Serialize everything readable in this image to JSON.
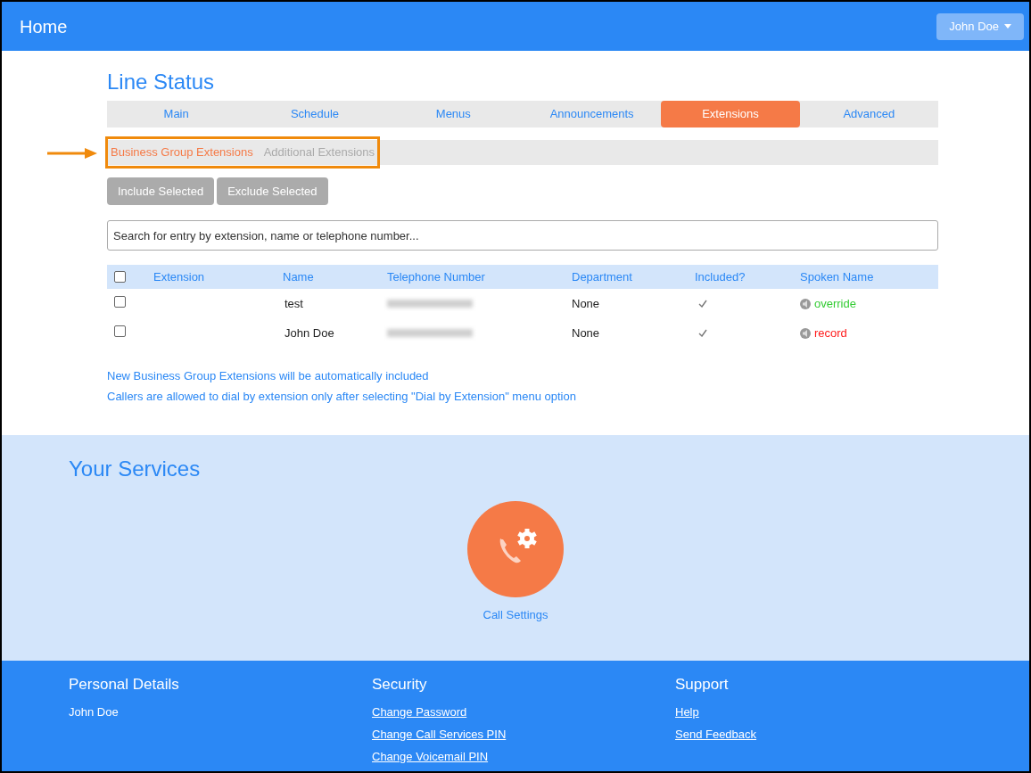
{
  "header": {
    "title": "Home",
    "user_menu": "John Doe"
  },
  "page_title": "Line Status",
  "tabs": [
    {
      "label": "Main",
      "selected": false
    },
    {
      "label": "Schedule",
      "selected": false
    },
    {
      "label": "Menus",
      "selected": false
    },
    {
      "label": "Announcements",
      "selected": false
    },
    {
      "label": "Extensions",
      "selected": true
    },
    {
      "label": "Advanced",
      "selected": false
    }
  ],
  "sub_tabs": [
    {
      "label": "Business Group Extensions",
      "selected": true
    },
    {
      "label": "Additional Extensions",
      "selected": false
    }
  ],
  "actions": [
    {
      "label": "Include Selected",
      "disabled": true
    },
    {
      "label": "Exclude Selected",
      "disabled": true
    }
  ],
  "search": {
    "placeholder": "Search for entry by extension, name or telephone number..."
  },
  "table": {
    "select_all_checked": false,
    "columns": [
      "Extension",
      "Name",
      "Telephone Number",
      "Department",
      "Included?",
      "Spoken Name"
    ],
    "rows": [
      {
        "checked": false,
        "name": "test",
        "department": "None",
        "included": true,
        "spoken_name": "override",
        "color": "#33cc33"
      },
      {
        "checked": false,
        "name": "John Doe",
        "department": "None",
        "included": true,
        "spoken_name": "record",
        "color": "#ff1a1a"
      }
    ]
  },
  "notes": [
    "New Business Group Extensions will be automatically included",
    "Callers are allowed to dial by extension only after selecting \"Dial by Extension\" menu option"
  ],
  "services": {
    "title": "Your Services",
    "items": [
      {
        "label": "Call Settings"
      }
    ]
  },
  "footer": [
    {
      "heading": "Personal Details",
      "items": [
        {
          "text": "John Doe",
          "link": false
        }
      ]
    },
    {
      "heading": "Security",
      "items": [
        {
          "text": "Change Password",
          "link": true
        },
        {
          "text": "Change Call Services PIN",
          "link": true
        },
        {
          "text": "Change Voicemail PIN",
          "link": true
        }
      ]
    },
    {
      "heading": "Support",
      "items": [
        {
          "text": "Help",
          "link": true
        },
        {
          "text": "Send Feedback",
          "link": true
        }
      ]
    }
  ]
}
